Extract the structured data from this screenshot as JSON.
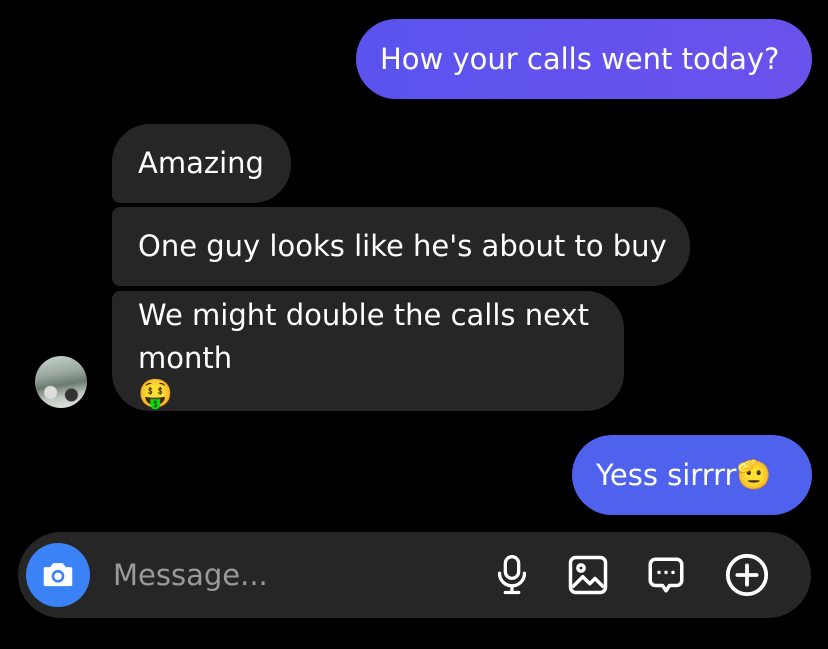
{
  "messages": [
    {
      "from": "me",
      "text": "How your calls went today?"
    },
    {
      "from": "them",
      "text": "Amazing"
    },
    {
      "from": "them",
      "text": "One guy looks like he's about to buy"
    },
    {
      "from": "them",
      "text_line1": "We might double the calls next",
      "text_line2": "month",
      "emoji": "🤑"
    },
    {
      "from": "me",
      "text": "Yess sirrrr",
      "emoji": "🫡"
    }
  ],
  "composer": {
    "placeholder": "Message...",
    "icons": [
      "camera-icon",
      "microphone-icon",
      "image-icon",
      "sticker-icon",
      "plus-icon"
    ]
  },
  "colors": {
    "sent_start": "#5b53ee",
    "sent_end": "#4f62ee",
    "received": "#262626",
    "camera_button": "#3b82f6"
  }
}
